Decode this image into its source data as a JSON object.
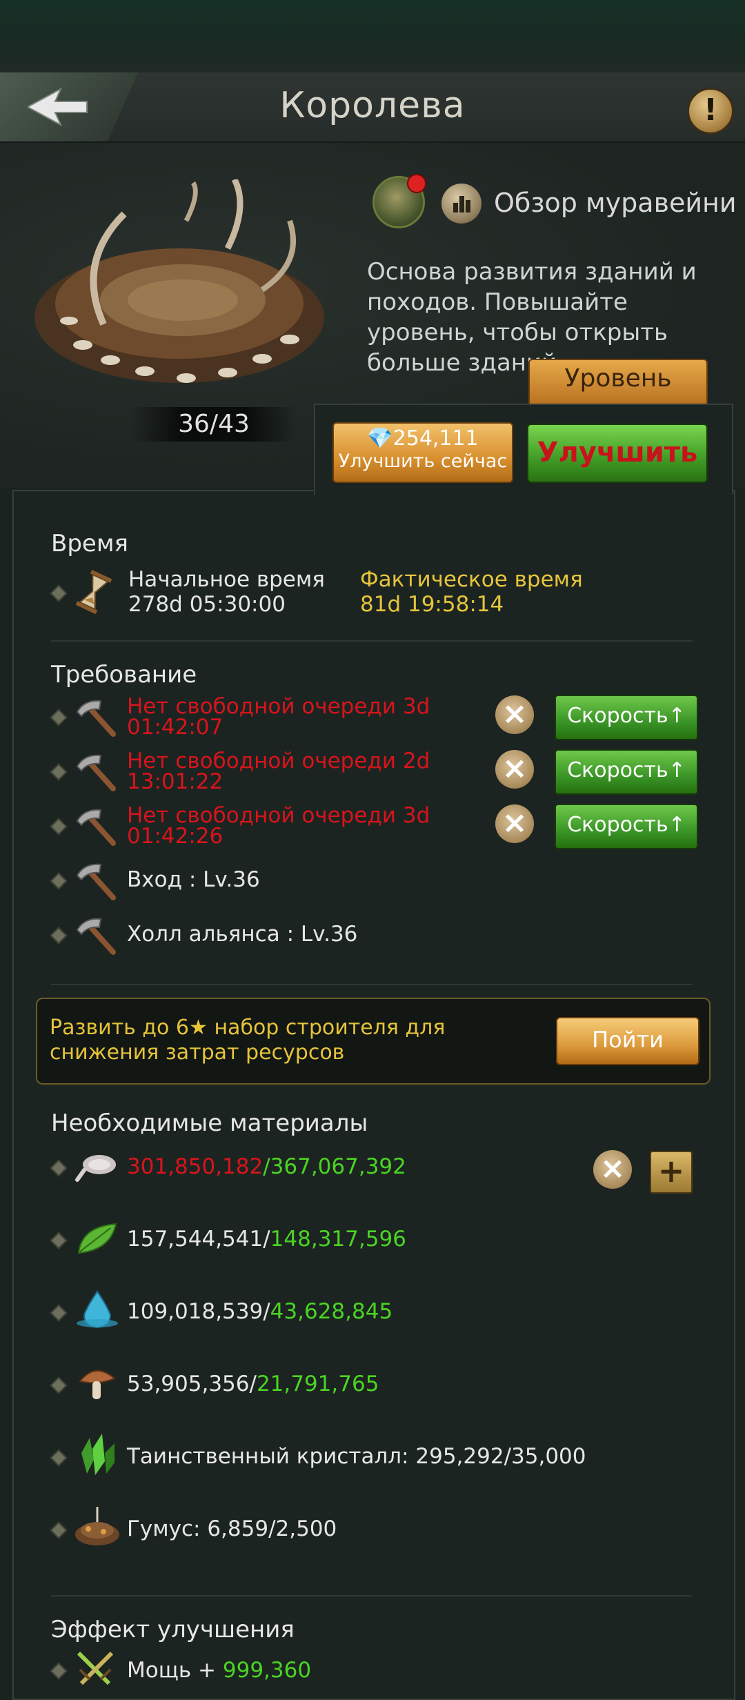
{
  "header": {
    "title": "Королева"
  },
  "building": {
    "progress": "36/43",
    "overview_label": "Обзор муравейни",
    "description": "Основа развития зданий и походов. Повышайте уровень, чтобы открыть больше зданий.",
    "glory_button": "Уровень славы"
  },
  "actions": {
    "gems": "254,111",
    "upgrade_now_label": "Улучшить сейчас",
    "upgrade_label": "Улучшить"
  },
  "time": {
    "section_title": "Время",
    "base_label": "Начальное время",
    "base_value": "278d 05:30:00",
    "actual_label": "Фактическое время",
    "actual_value": "81d 19:58:14"
  },
  "requirements": {
    "section_title": "Требование",
    "queues": [
      {
        "line1": "Нет свободной очереди   3d",
        "line2": "01:42:07",
        "speed_label": "Скорость↑"
      },
      {
        "line1": "Нет свободной очереди   2d",
        "line2": "13:01:22",
        "speed_label": "Скорость↑"
      },
      {
        "line1": "Нет свободной очереди   3d",
        "line2": "01:42:26",
        "speed_label": "Скорость↑"
      }
    ],
    "buildings": [
      {
        "label": "Вход : Lv.36"
      },
      {
        "label": "Холл альянса : Lv.36"
      }
    ]
  },
  "promo": {
    "text": "Развить до  6★ набор строителя для снижения затрат ресурсов",
    "button": "Пойти"
  },
  "materials": {
    "section_title": "Необходимые материалы",
    "items": [
      {
        "icon": "meat-icon",
        "have": "301,850,182",
        "need": "/367,067,392"
      },
      {
        "icon": "leaf-icon",
        "have": "157,544,541/",
        "need": "148,317,596"
      },
      {
        "icon": "water-drop-icon",
        "have": "109,018,539/",
        "need": "43,628,845"
      },
      {
        "icon": "mushroom-icon",
        "have": "53,905,356/",
        "need": "21,791,765"
      },
      {
        "icon": "crystal-icon",
        "label": "Таинственный кристалл: 295,292/35,000"
      },
      {
        "icon": "humus-icon",
        "label": "Гумус: 6,859/2,500"
      }
    ]
  },
  "effect": {
    "section_title": "Эффект улучшения",
    "power_label": "Мощь + ",
    "power_value": "999,360"
  },
  "colors": {
    "accent_red": "#d8141c",
    "accent_green": "#4bd423",
    "accent_yellow": "#e7c53b"
  }
}
